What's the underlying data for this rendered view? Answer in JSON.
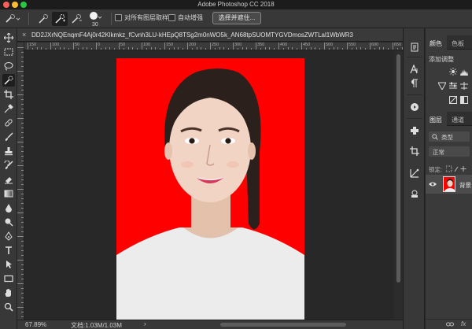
{
  "window": {
    "title": "Adobe Photoshop CC 2018"
  },
  "options_bar": {
    "brush_size": "30",
    "sample_all_layers_label": "对所有图层取样",
    "auto_enhance_label": "自动增强",
    "select_mask_label": "选择并遮住..."
  },
  "document": {
    "tab_title": "DD2JXrNQEnqmF4Aj0r42Klkmkz_fCvnh3LU-kHEpQ8TSg2m0nWO5k_AN68tpSUOMTYGVDmosZWTLal1WbWR3",
    "background_color": "#ff0000"
  },
  "rulers": {
    "top_labels": [
      "150",
      "100",
      "50",
      "0",
      "50",
      "100",
      "150",
      "200",
      "250",
      "300",
      "350",
      "400",
      "450",
      "500",
      "550",
      "600",
      "650"
    ]
  },
  "status_bar": {
    "zoom": "67.89%",
    "doc_size": "文档:1.03M/1.03M",
    "arrow": "›"
  },
  "right_panel": {
    "top_tabs": [
      "颜色",
      "色板"
    ],
    "adjustments_title": "添加调整",
    "layers_tabs": [
      "图层",
      "通道"
    ],
    "kind_filter": "类型",
    "blend_mode": "正常",
    "lock_label": "锁定:",
    "layer_name": "背景",
    "fx_label": "fx"
  },
  "icons": {
    "tools": [
      "move-icon",
      "marquee-icon",
      "lasso-icon",
      "quick-selection-icon",
      "crop-icon",
      "eyedropper-icon",
      "healing-brush-icon",
      "brush-icon",
      "clone-stamp-icon",
      "history-brush-icon",
      "eraser-icon",
      "gradient-icon",
      "blur-icon",
      "dodge-icon",
      "pen-icon",
      "type-icon",
      "path-selection-icon",
      "rectangle-icon",
      "hand-icon",
      "zoom-icon"
    ],
    "panel_icons": [
      "history-icon",
      "character-icon",
      "paragraph-icon",
      "actions-icon",
      "navigator-icon",
      "properties-icon",
      "libraries-icon",
      "3d-icon"
    ]
  },
  "colors": {
    "accent_background": "#ff0000",
    "ui_dark": "#383838",
    "canvas_bg": "#282828"
  }
}
